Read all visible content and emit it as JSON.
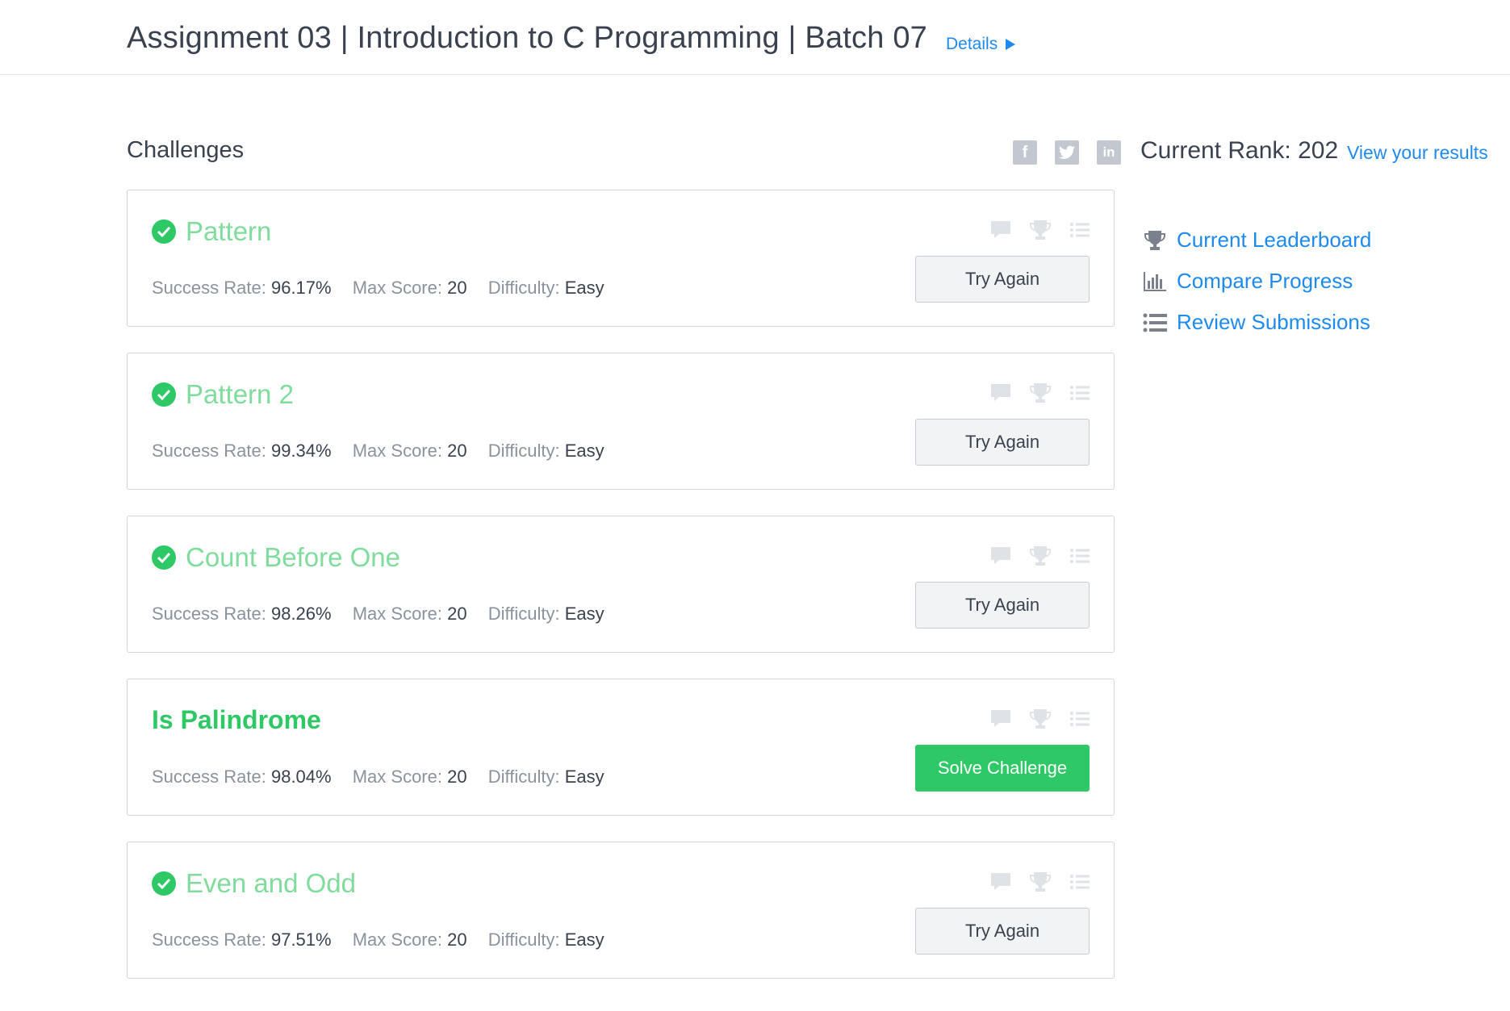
{
  "header": {
    "title": "Assignment 03 | Introduction to C Programming | Batch 07",
    "details_label": "Details"
  },
  "challenges_section": {
    "title": "Challenges"
  },
  "social": [
    "facebook",
    "twitter",
    "linkedin"
  ],
  "sidebar": {
    "rank_label": "Current Rank: 202",
    "view_results_label": "View your results",
    "links": [
      {
        "label": "Current Leaderboard",
        "icon": "trophy-icon"
      },
      {
        "label": "Compare Progress",
        "icon": "bar-chart-icon"
      },
      {
        "label": "Review Submissions",
        "icon": "list-icon"
      }
    ]
  },
  "labels": {
    "success_rate": "Success Rate:",
    "max_score": "Max Score:",
    "difficulty": "Difficulty:"
  },
  "challenges": [
    {
      "name": "Pattern",
      "solved": true,
      "success_rate": "96.17%",
      "max_score": "20",
      "difficulty": "Easy",
      "button": "Try Again"
    },
    {
      "name": "Pattern 2",
      "solved": true,
      "success_rate": "99.34%",
      "max_score": "20",
      "difficulty": "Easy",
      "button": "Try Again"
    },
    {
      "name": "Count Before One",
      "solved": true,
      "success_rate": "98.26%",
      "max_score": "20",
      "difficulty": "Easy",
      "button": "Try Again"
    },
    {
      "name": "Is Palindrome",
      "solved": false,
      "success_rate": "98.04%",
      "max_score": "20",
      "difficulty": "Easy",
      "button": "Solve Challenge"
    },
    {
      "name": "Even and Odd",
      "solved": true,
      "success_rate": "97.51%",
      "max_score": "20",
      "difficulty": "Easy",
      "button": "Try Again"
    }
  ],
  "colors": {
    "accent_blue": "#1f8aed",
    "success_green": "#2ec866",
    "solved_title_green": "#7fdc9d",
    "text_dark": "#39424e"
  }
}
